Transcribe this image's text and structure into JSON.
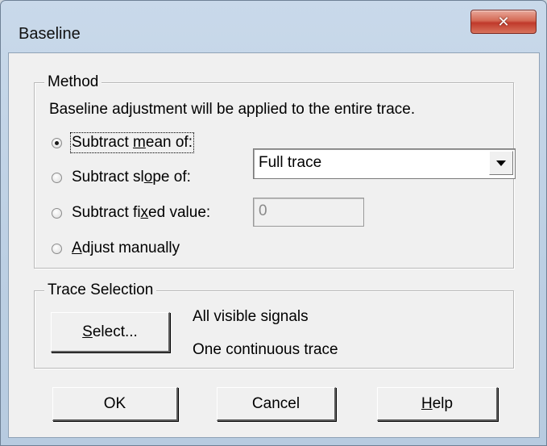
{
  "window": {
    "title": "Baseline",
    "close_glyph": "✕"
  },
  "method": {
    "legend": "Method",
    "description": "Baseline adjustment will be applied to the entire trace.",
    "options": [
      {
        "pre": "Subtract ",
        "key": "m",
        "post": "ean of:",
        "selected": true
      },
      {
        "pre": "Subtract sl",
        "key": "o",
        "post": "pe of:",
        "selected": false
      },
      {
        "pre": "Subtract fi",
        "key": "x",
        "post": "ed value:",
        "selected": false
      },
      {
        "pre": "",
        "key": "A",
        "post": "djust manually",
        "selected": false
      }
    ],
    "range_select": {
      "value": "Full trace"
    },
    "fixed_value": {
      "value": "0"
    }
  },
  "trace_selection": {
    "legend": "Trace Selection",
    "select_button": {
      "key": "S",
      "post": "elect..."
    },
    "summary_line1": "All visible signals",
    "summary_line2": "One continuous trace"
  },
  "buttons": {
    "ok": "OK",
    "cancel": "Cancel",
    "help": {
      "key": "H",
      "post": "elp"
    }
  },
  "colors": {
    "face": "#f0f0f0",
    "close_red": "#c0392b",
    "frame": "#bccfe3"
  }
}
